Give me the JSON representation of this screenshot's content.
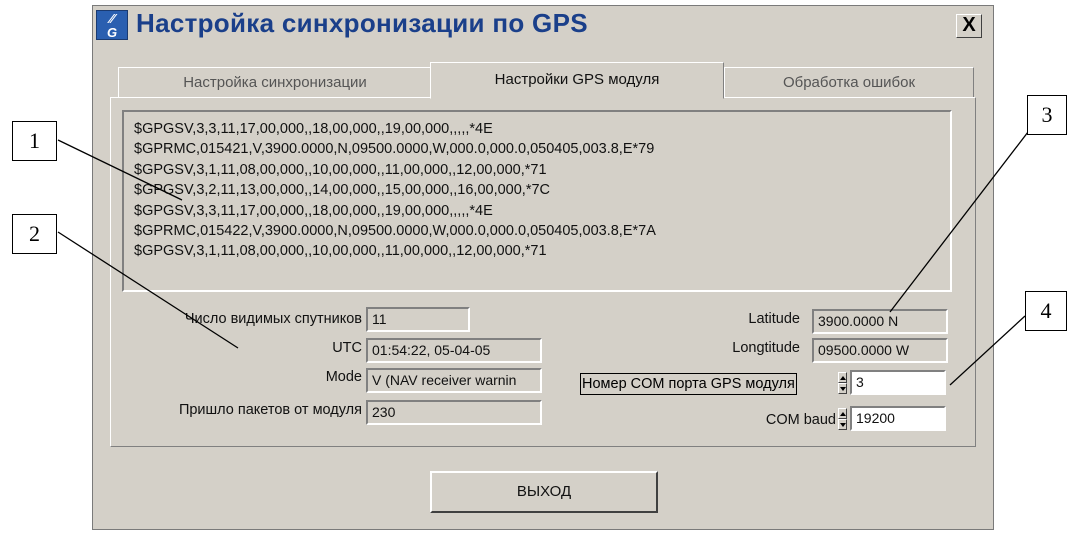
{
  "window": {
    "title": "Настройка синхронизации по GPS",
    "close_label": "X",
    "app_icon": "GPS-sync-icon"
  },
  "tabs": [
    {
      "label": "Настройка синхронизации"
    },
    {
      "label": "Настройки GPS модуля"
    },
    {
      "label": "Обработка ошибок"
    }
  ],
  "nmea_lines": [
    "$GPGSV,3,3,11,17,00,000,,18,00,000,,19,00,000,,,,,*4E",
    "$GPRMC,015421,V,3900.0000,N,09500.0000,W,000.0,000.0,050405,003.8,E*79",
    "$GPGSV,3,1,11,08,00,000,,10,00,000,,11,00,000,,12,00,000,*71",
    "$GPGSV,3,2,11,13,00,000,,14,00,000,,15,00,000,,16,00,000,*7C",
    "$GPGSV,3,3,11,17,00,000,,18,00,000,,19,00,000,,,,,*4E",
    "$GPRMC,015422,V,3900.0000,N,09500.0000,W,000.0,000.0,050405,003.8,E*7A",
    "$GPGSV,3,1,11,08,00,000,,10,00,000,,11,00,000,,12,00,000,*71"
  ],
  "status": {
    "satellites_label": "Число видимых спутников",
    "satellites_value": "11",
    "utc_label": "UTC",
    "utc_value": "01:54:22,  05-04-05",
    "mode_label": "Mode",
    "mode_value": "V (NAV receiver warnin",
    "packets_label": "Пришло пакетов от модуля",
    "packets_value": "230",
    "latitude_label": "Latitude",
    "latitude_value": "3900.0000 N",
    "longitude_label": "Longtitude",
    "longitude_value": "09500.0000 W"
  },
  "settings": {
    "com_port_label": "Номер COM порта GPS модуля",
    "com_port_value": "3",
    "com_baud_label": "COM baud",
    "com_baud_value": "19200"
  },
  "exit_label": "ВЫХОД",
  "callouts": [
    "1",
    "2",
    "3",
    "4"
  ]
}
